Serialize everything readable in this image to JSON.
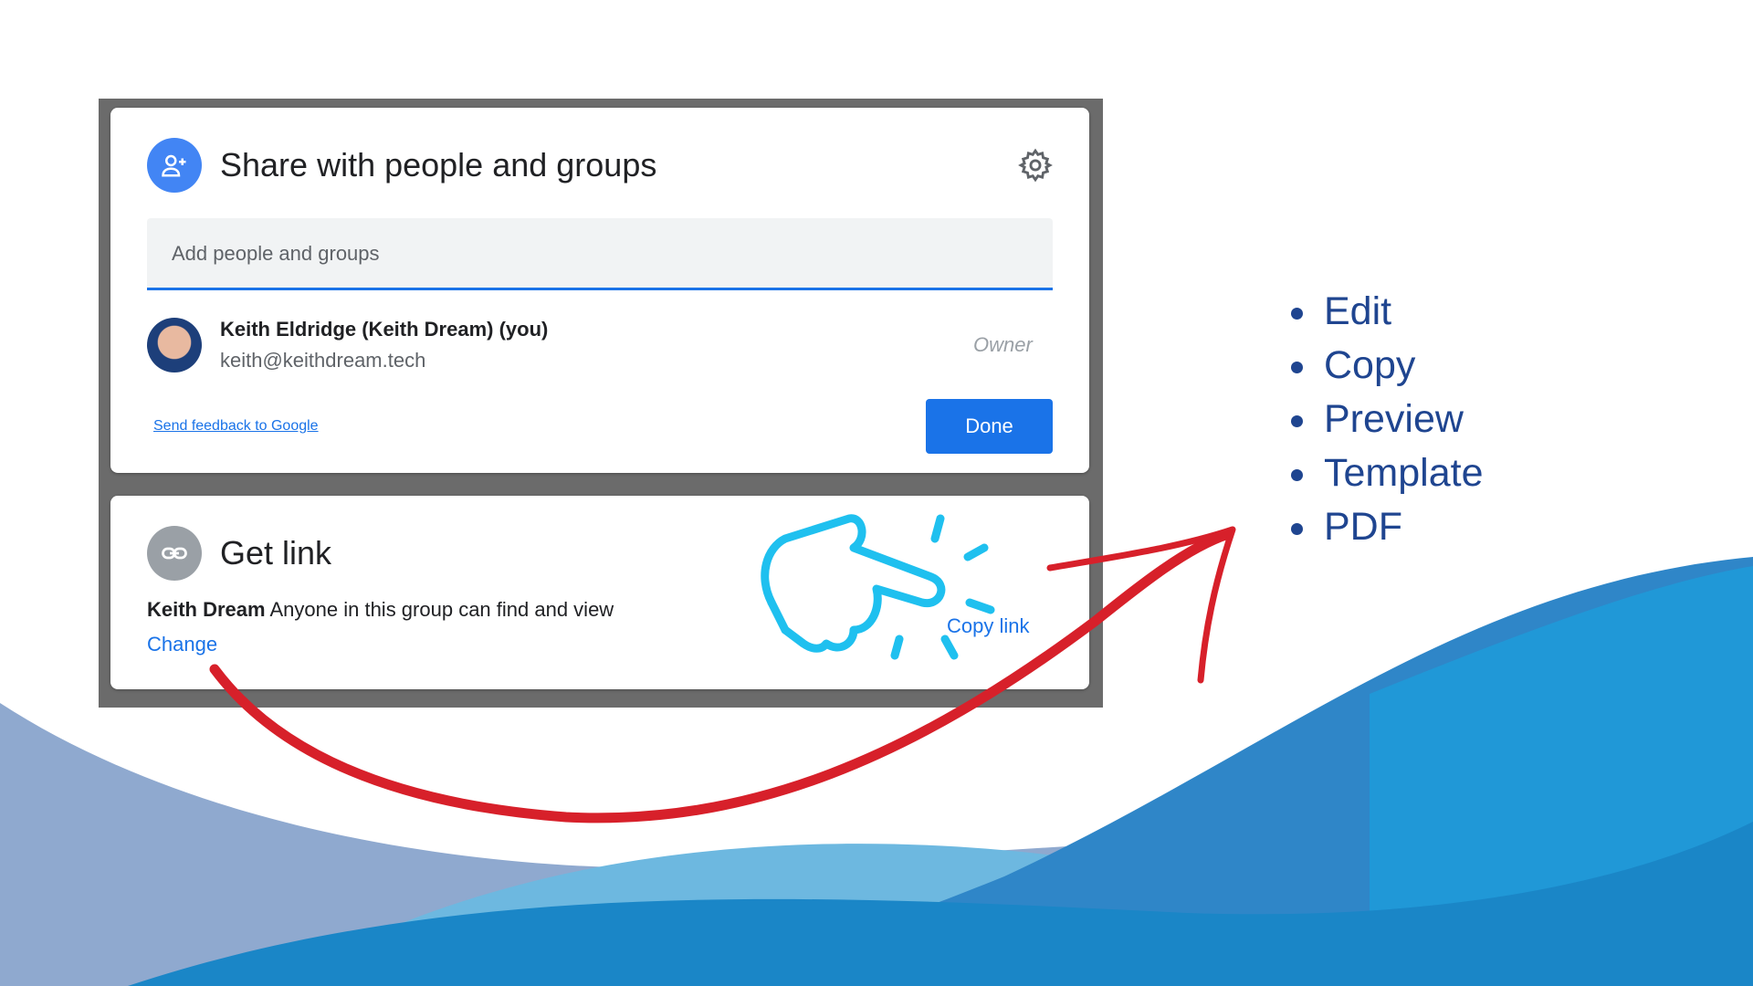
{
  "share_dialog": {
    "title": "Share with people and groups",
    "icons": {
      "header": "person-add-icon",
      "settings": "gear-icon"
    },
    "input_placeholder": "Add people and groups",
    "person": {
      "name": "Keith Eldridge (Keith Dream) (you)",
      "email": "keith@keithdream.tech",
      "role": "Owner"
    },
    "feedback_link": "Send feedback to Google",
    "done_label": "Done"
  },
  "get_link": {
    "title": "Get link",
    "icon": "link-icon",
    "group": "Keith Dream",
    "description": "Anyone in this group can find and view",
    "change_label": "Change",
    "copy_link_label": "Copy link"
  },
  "bullets": [
    "Edit",
    "Copy",
    "Preview",
    "Template",
    "PDF"
  ],
  "colors": {
    "accent": "#1a73e8",
    "bullet_text": "#1f4590",
    "arrow": "#d7202a",
    "hand": "#1fc0ef"
  }
}
